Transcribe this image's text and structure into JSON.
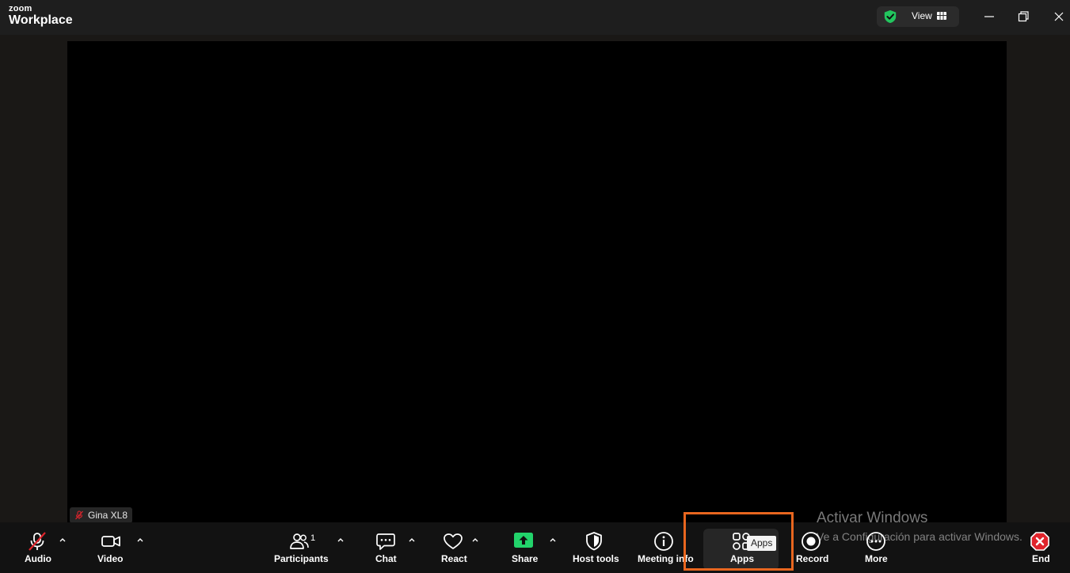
{
  "titlebar": {
    "brand_small": "zoom",
    "brand_large": "Workplace",
    "view_label": "View",
    "icons": {
      "security": "shield-check-icon",
      "view": "grid-icon",
      "minimize": "minimize-icon",
      "restore": "restore-icon",
      "close": "close-icon"
    }
  },
  "video": {
    "participant_name": "Gina XL8"
  },
  "toolbar": {
    "audio": "Audio",
    "video": "Video",
    "participants": "Participants",
    "participants_count": "1",
    "chat": "Chat",
    "react": "React",
    "share": "Share",
    "host_tools": "Host tools",
    "meeting_info": "Meeting info",
    "apps": "Apps",
    "record": "Record",
    "more": "More",
    "end": "End"
  },
  "tooltip": {
    "apps": "Apps"
  },
  "watermark": {
    "line1": "Activar Windows",
    "line2": "Ve a Configuración para activar Windows."
  },
  "colors": {
    "share_green": "#22d36b",
    "end_red": "#e0242c",
    "highlight_orange": "#e8661f",
    "mic_off_red": "#e0242c",
    "shield_green": "#22c55e"
  }
}
